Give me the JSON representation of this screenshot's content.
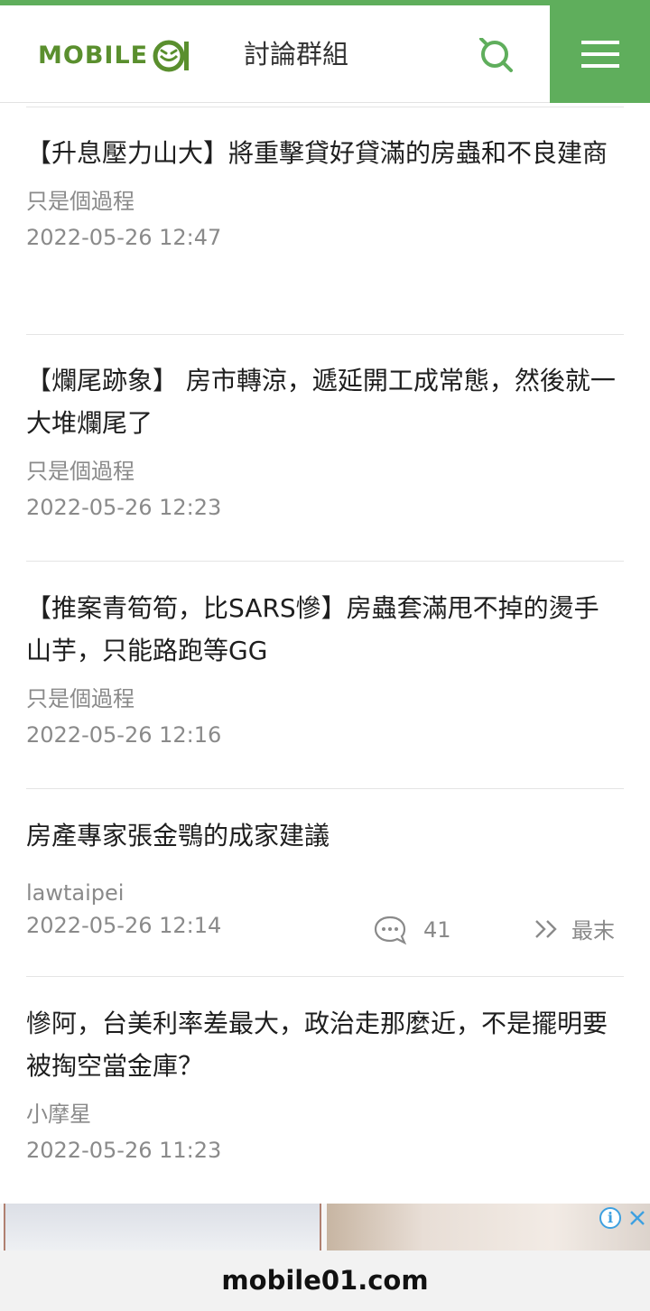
{
  "header": {
    "logo_text": "MOBILE",
    "section_title": "討論群組",
    "search_icon": "search-icon",
    "menu_icon": "hamburger-menu-icon",
    "brand_color": "#5fae5c"
  },
  "threads": [
    {
      "title": "【升息壓力山大】將重擊貸好貸滿的房蟲和不良建商",
      "author": "只是個過程",
      "date": "2022-05-26 12:47"
    },
    {
      "title": "【爛尾跡象】 房市轉涼，遞延開工成常態，然後就一大堆爛尾了",
      "author": "只是個過程",
      "date": "2022-05-26 12:23"
    },
    {
      "title": "【推案青筍筍，比SARS慘】房蟲套滿甩不掉的燙手山芋，只能路跑等GG",
      "author": "只是個過程",
      "date": "2022-05-26 12:16"
    },
    {
      "title": "房產專家張金鶚的成家建議",
      "author": "lawtaipei",
      "date": "2022-05-26 12:14",
      "replies": "41",
      "last_label": "最末"
    },
    {
      "title": "慘阿，台美利率差最大，政治走那麼近，不是擺明要被掏空當金庫？",
      "author": "小摩星",
      "date": "2022-05-26 11:23"
    }
  ],
  "ad": {
    "info_icon": "info-icon",
    "close_icon": "close-icon"
  },
  "footer": {
    "domain": "mobile01.com"
  }
}
